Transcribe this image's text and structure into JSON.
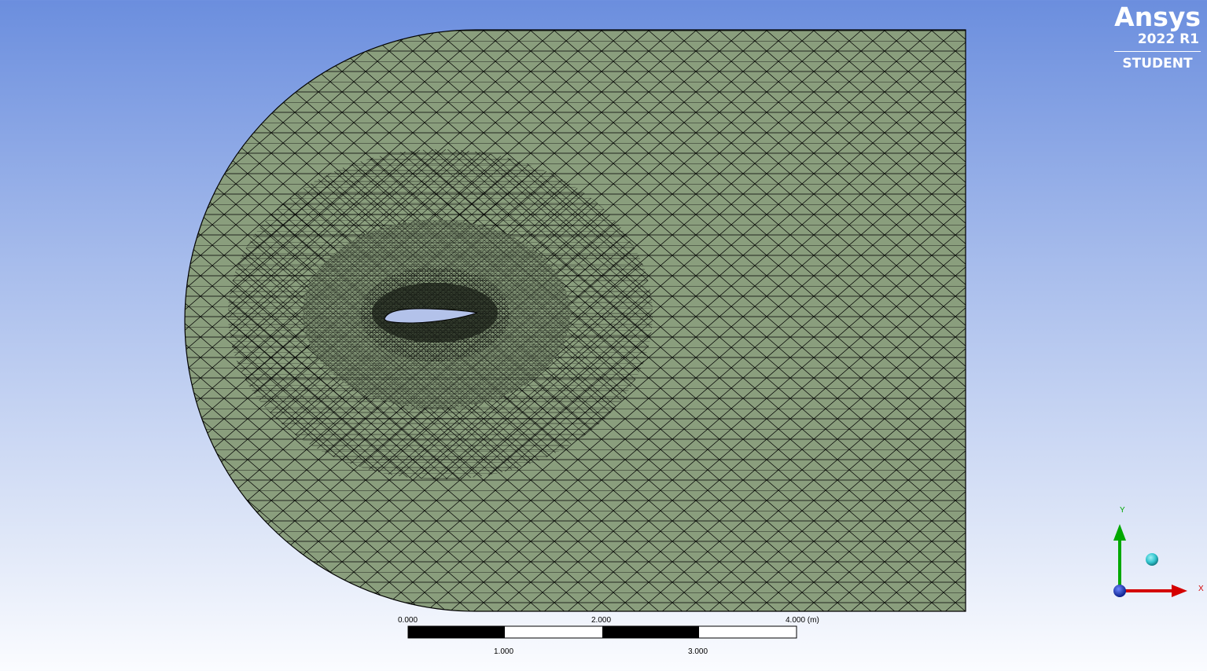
{
  "branding": {
    "brand": "Ansys",
    "release": "2022 R1",
    "edition": "STUDENT"
  },
  "colors": {
    "mesh_fill": "#8a9e7d",
    "mesh_lines": "#000000",
    "airfoil_fill": "#b3c2ea",
    "axis_x": "#d40000",
    "axis_y": "#00a800",
    "axis_z_dot": "#1e40c8",
    "view_ball": "#33c6cf"
  },
  "scale_bar": {
    "top_labels": [
      "0.000",
      "2.000",
      "4.000 (m)"
    ],
    "bottom_labels": [
      "1.000",
      "3.000"
    ]
  },
  "triad": {
    "x_label": "X",
    "y_label": "Y"
  },
  "icons": [
    "ansys-logo",
    "axis-triad-icon",
    "view-ball-icon"
  ]
}
